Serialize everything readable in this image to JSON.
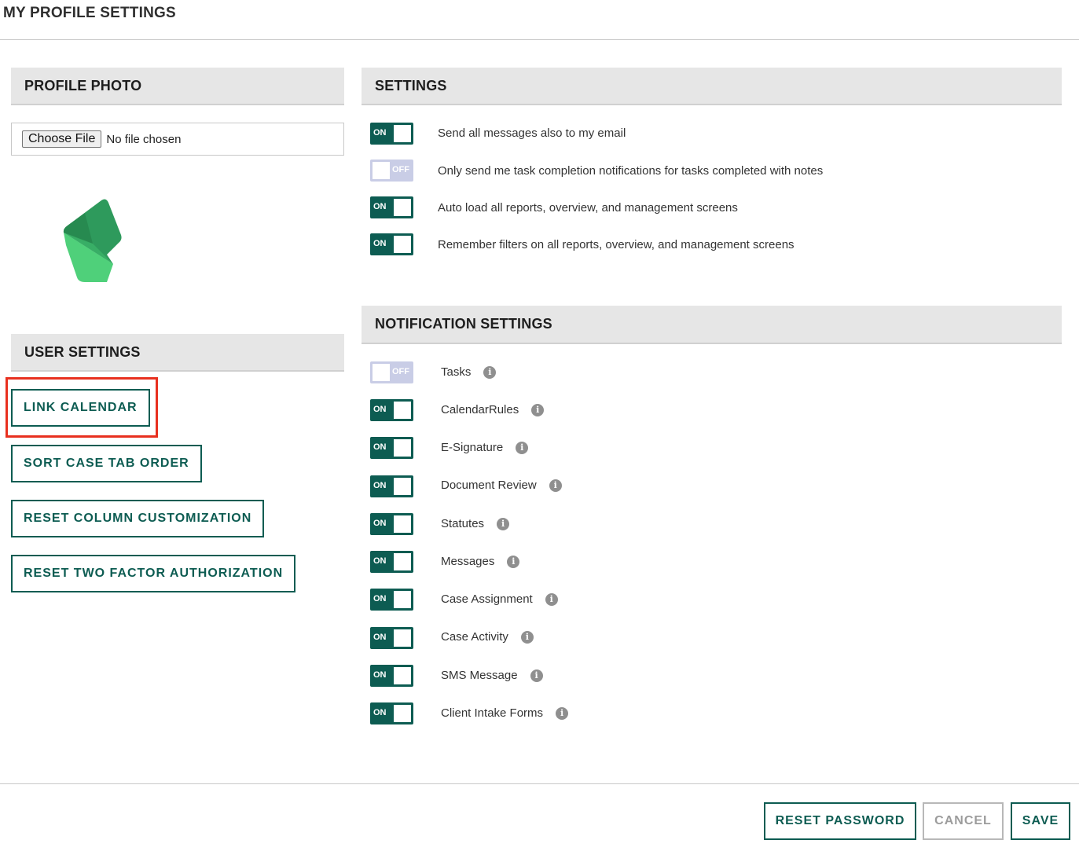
{
  "page_title": "MY PROFILE SETTINGS",
  "profile_photo": {
    "header": "PROFILE PHOTO",
    "choose_file_label": "Choose File",
    "file_status": "No file chosen"
  },
  "user_settings": {
    "header": "USER SETTINGS",
    "buttons": [
      {
        "label": "LINK CALENDAR"
      },
      {
        "label": "SORT CASE TAB ORDER"
      },
      {
        "label": "RESET COLUMN CUSTOMIZATION"
      },
      {
        "label": "RESET TWO FACTOR AUTHORIZATION"
      }
    ]
  },
  "settings": {
    "header": "SETTINGS",
    "items": [
      {
        "state": "ON",
        "label": "Send all messages also to my email"
      },
      {
        "state": "OFF",
        "label": "Only send me task completion notifications for tasks completed with notes"
      },
      {
        "state": "ON",
        "label": "Auto load all reports, overview, and management screens"
      },
      {
        "state": "ON",
        "label": "Remember filters on all reports, overview, and management screens"
      }
    ]
  },
  "notification_settings": {
    "header": "NOTIFICATION SETTINGS",
    "info_glyph": "i",
    "items": [
      {
        "state": "OFF",
        "label": "Tasks"
      },
      {
        "state": "ON",
        "label": "CalendarRules"
      },
      {
        "state": "ON",
        "label": "E-Signature"
      },
      {
        "state": "ON",
        "label": "Document Review"
      },
      {
        "state": "ON",
        "label": "Statutes"
      },
      {
        "state": "ON",
        "label": "Messages"
      },
      {
        "state": "ON",
        "label": "Case Assignment"
      },
      {
        "state": "ON",
        "label": "Case Activity"
      },
      {
        "state": "ON",
        "label": "SMS Message"
      },
      {
        "state": "ON",
        "label": "Client Intake Forms"
      }
    ]
  },
  "footer": {
    "reset_password_label": "RESET PASSWORD",
    "cancel_label": "CANCEL",
    "save_label": "SAVE"
  },
  "colors": {
    "accent": "#0d5c52",
    "toggle_off": "#c9cde6",
    "highlight": "#e8301f",
    "logo_dark": "#2e9a5c",
    "logo_light": "#4fd07a"
  }
}
